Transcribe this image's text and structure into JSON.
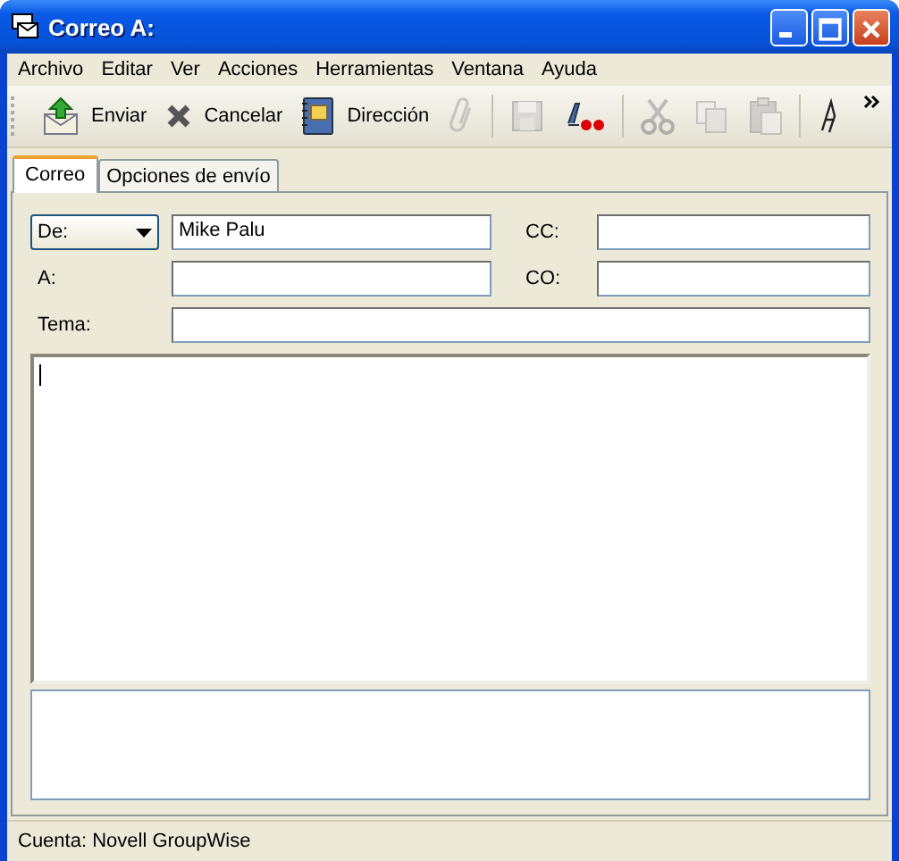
{
  "window": {
    "title": "Correo A:"
  },
  "menu": [
    "Archivo",
    "Editar",
    "Ver",
    "Acciones",
    "Herramientas",
    "Ventana",
    "Ayuda"
  ],
  "toolbar": [
    {
      "kind": "labeled",
      "label": "Enviar",
      "disabled": false
    },
    {
      "kind": "labeled",
      "label": "Cancelar",
      "disabled": false
    },
    {
      "kind": "labeled",
      "label": "Dirección",
      "disabled": false
    },
    {
      "kind": "icon",
      "disabled": true
    },
    {
      "kind": "separator"
    },
    {
      "kind": "icon",
      "disabled": true
    },
    {
      "kind": "icon",
      "disabled": false
    },
    {
      "kind": "separator"
    },
    {
      "kind": "icon",
      "disabled": true
    },
    {
      "kind": "icon",
      "disabled": true
    },
    {
      "kind": "icon",
      "disabled": true
    },
    {
      "kind": "separator"
    },
    {
      "kind": "icon",
      "disabled": false
    }
  ],
  "tabs": [
    {
      "label": "Correo",
      "selected": true
    },
    {
      "label": "Opciones de envío",
      "selected": false
    }
  ],
  "from": {
    "label": "De:",
    "value": "Mike Palu"
  },
  "to": {
    "label": "A:"
  },
  "cc": {
    "label": "CC:"
  },
  "bcc": {
    "label": "CO:"
  },
  "subject": {
    "label": "Tema:"
  },
  "status_bar": "Cuenta: Novell GroupWise"
}
